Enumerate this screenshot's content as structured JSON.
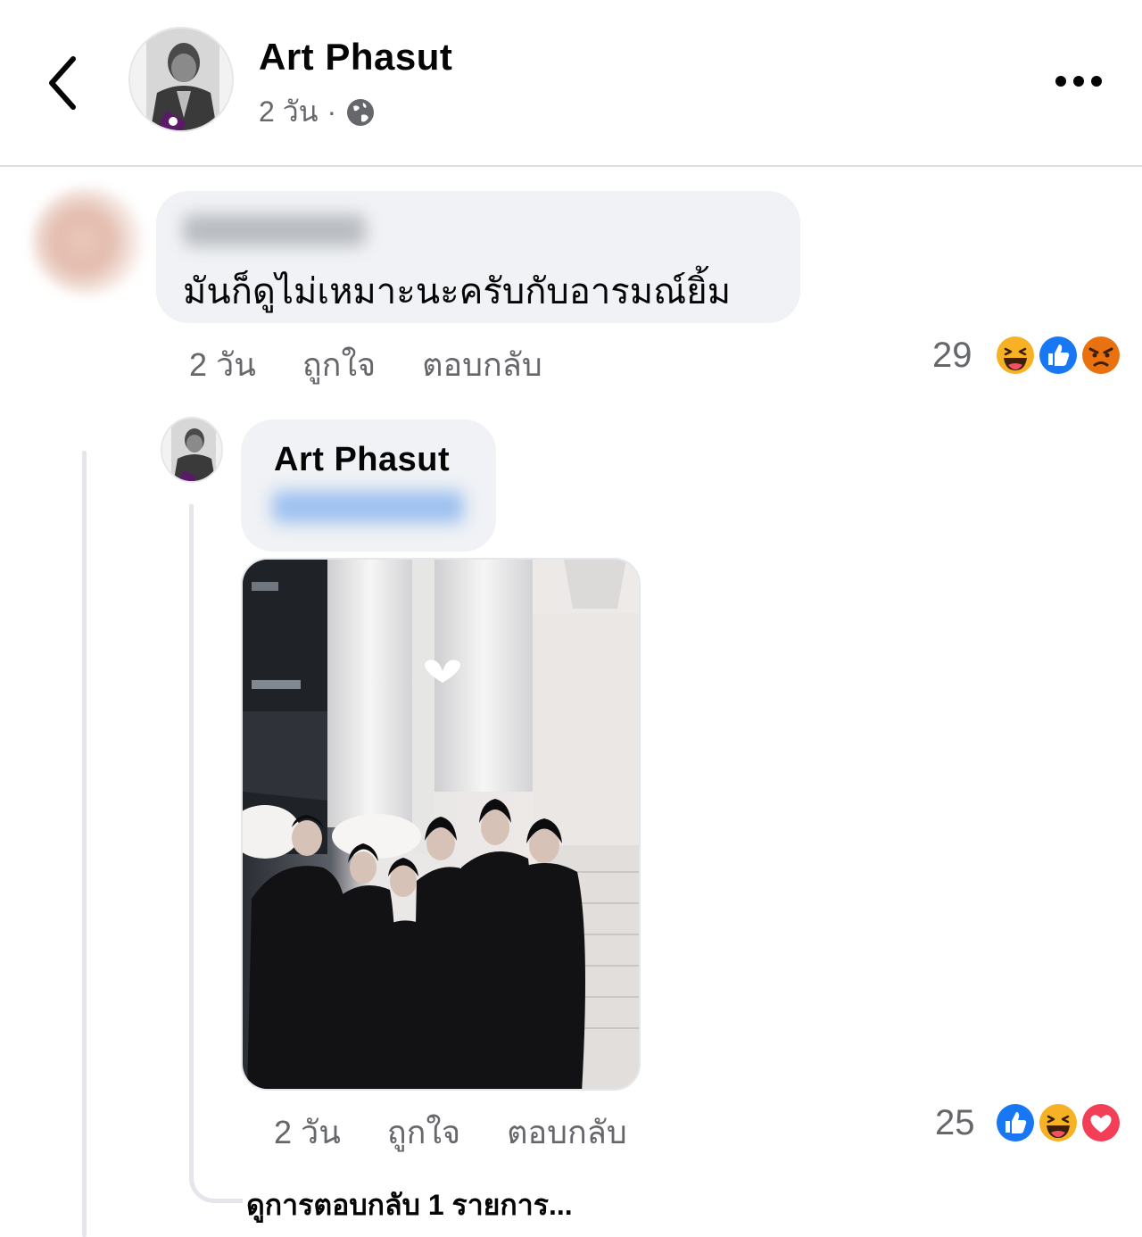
{
  "header": {
    "back_icon": "chevron-left-icon",
    "name": "Art Phasut",
    "time": "2 วัน",
    "separator": "·",
    "privacy_icon": "globe-icon",
    "more_icon": "ellipsis-icon"
  },
  "comment": {
    "text": "มันก็ดูไม่เหมาะนะครับกับอารมณ์ยิ้ม",
    "time": "2 วัน",
    "like_label": "ถูกใจ",
    "reply_label": "ตอบกลับ",
    "reaction_count": "29",
    "reactions": [
      "haha",
      "like",
      "angry"
    ]
  },
  "reply": {
    "name": "Art Phasut",
    "time": "2 วัน",
    "like_label": "ถูกใจ",
    "reply_label": "ตอบกลับ",
    "reaction_count": "25",
    "reactions": [
      "like",
      "haha",
      "love"
    ],
    "view_replies": "ดูการตอบกลับ 1 รายการ..."
  },
  "colors": {
    "secondary_text": "#65676b",
    "bubble": "#f0f2f5",
    "like_blue": "#1877f2",
    "love_red": "#f33e58",
    "haha_yellow": "#f7b125",
    "angry_orange": "#e9710f"
  }
}
